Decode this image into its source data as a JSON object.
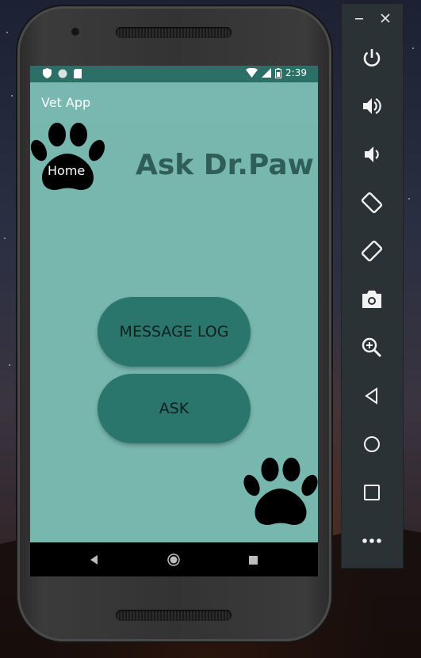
{
  "status_bar": {
    "time": "2:39"
  },
  "app_bar": {
    "title": "Vet App"
  },
  "main": {
    "heading": "Ask Dr.Paw",
    "home_label": "Home",
    "message_log_label": "MESSAGE LOG",
    "ask_label": "ASK"
  },
  "nav_bar": {
    "icons": [
      "back-icon",
      "home-icon",
      "recents-icon"
    ]
  },
  "emulator_panel": {
    "window_controls": [
      "minimize-icon",
      "close-icon"
    ],
    "buttons": [
      "power-icon",
      "volume-up-icon",
      "volume-down-icon",
      "rotate-left-icon",
      "rotate-right-icon",
      "camera-icon",
      "zoom-icon",
      "back-icon",
      "home-icon",
      "overview-icon",
      "more-icon"
    ]
  },
  "colors": {
    "status_bar": "#2b6f66",
    "app_bar": "#78b8b0",
    "content_bg": "#77b7ae",
    "button": "#2a766d",
    "heading": "#2f5e59",
    "panel": "#2b3236"
  }
}
